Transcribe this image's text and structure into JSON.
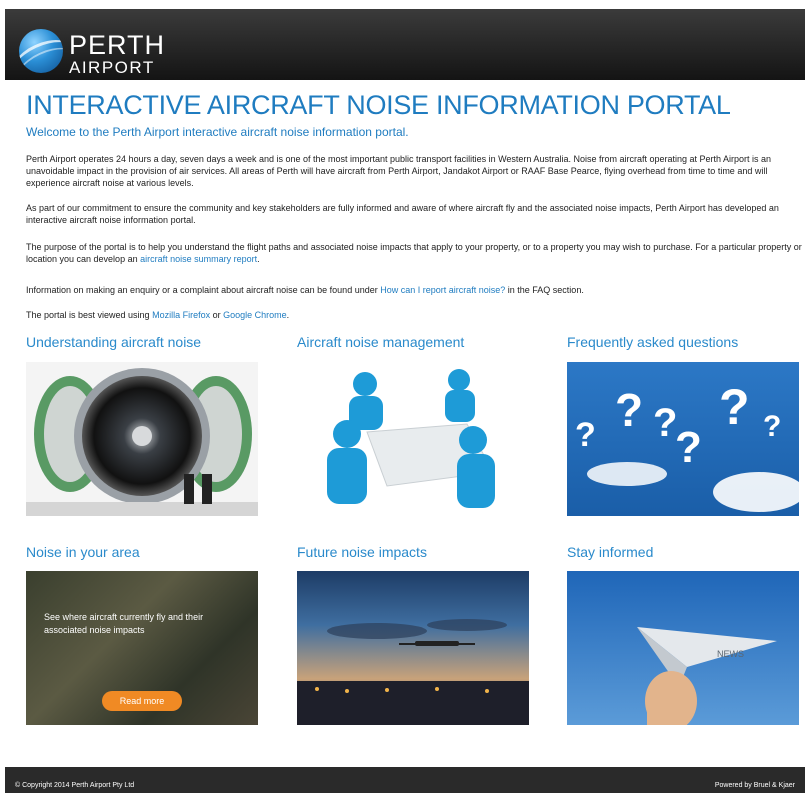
{
  "header": {
    "brand_line1": "PERTH",
    "brand_line2": "AIRPORT"
  },
  "page": {
    "title": "INTERACTIVE AIRCRAFT NOISE INFORMATION PORTAL",
    "welcome": "Welcome to the Perth Airport interactive aircraft noise information portal."
  },
  "paragraphs": {
    "p1": "Perth Airport operates 24 hours a day, seven days a week and is one of the most important public transport facilities in Western Australia. Noise from aircraft operating at Perth Airport is an unavoidable impact in the provision of air services. All areas of Perth will have aircraft from Perth Airport, Jandakot Airport or RAAF Base Pearce, flying overhead from time to time and will experience aircraft noise at various levels.",
    "p2": "As part of our commitment to ensure the community and key stakeholders are fully informed and aware of where aircraft fly and the associated noise impacts, Perth Airport has developed an interactive aircraft noise information portal.",
    "p3_text": "The purpose of the portal is to help you understand the flight paths and associated noise impacts that apply to your property, or to a property you may wish to purchase. For a particular property or location you can develop an ",
    "p3_link": "aircraft noise summary report",
    "p3_end": ".",
    "p4_text": "Information on making an enquiry or a complaint about aircraft noise can be found under ",
    "p4_link": "How can I report aircraft noise?",
    "p4_end": " in the FAQ section.",
    "p5_text": "The portal is best viewed using ",
    "p5_link1": "Mozilla Firefox",
    "p5_mid": " or ",
    "p5_link2": "Google Chrome",
    "p5_end": "."
  },
  "sections": {
    "s1": "Understanding aircraft noise",
    "s2": "Aircraft noise management",
    "s3": "Frequently asked questions",
    "s4": "Noise in your area",
    "s5": "Future noise impacts",
    "s6": "Stay informed"
  },
  "noise_area": {
    "overlay_text": "See where aircraft currently fly and their associated noise impacts",
    "read_more": "Read more"
  },
  "paper_plane_text": "NEWS",
  "footer": {
    "copyright": "© Copyright 2014 Perth Airport Pty Ltd",
    "powered": "Powered by Bruel & Kjaer"
  },
  "colors": {
    "accent": "#1f7cc0",
    "header_bg": "#1c1c1c",
    "button": "#f08a24"
  }
}
